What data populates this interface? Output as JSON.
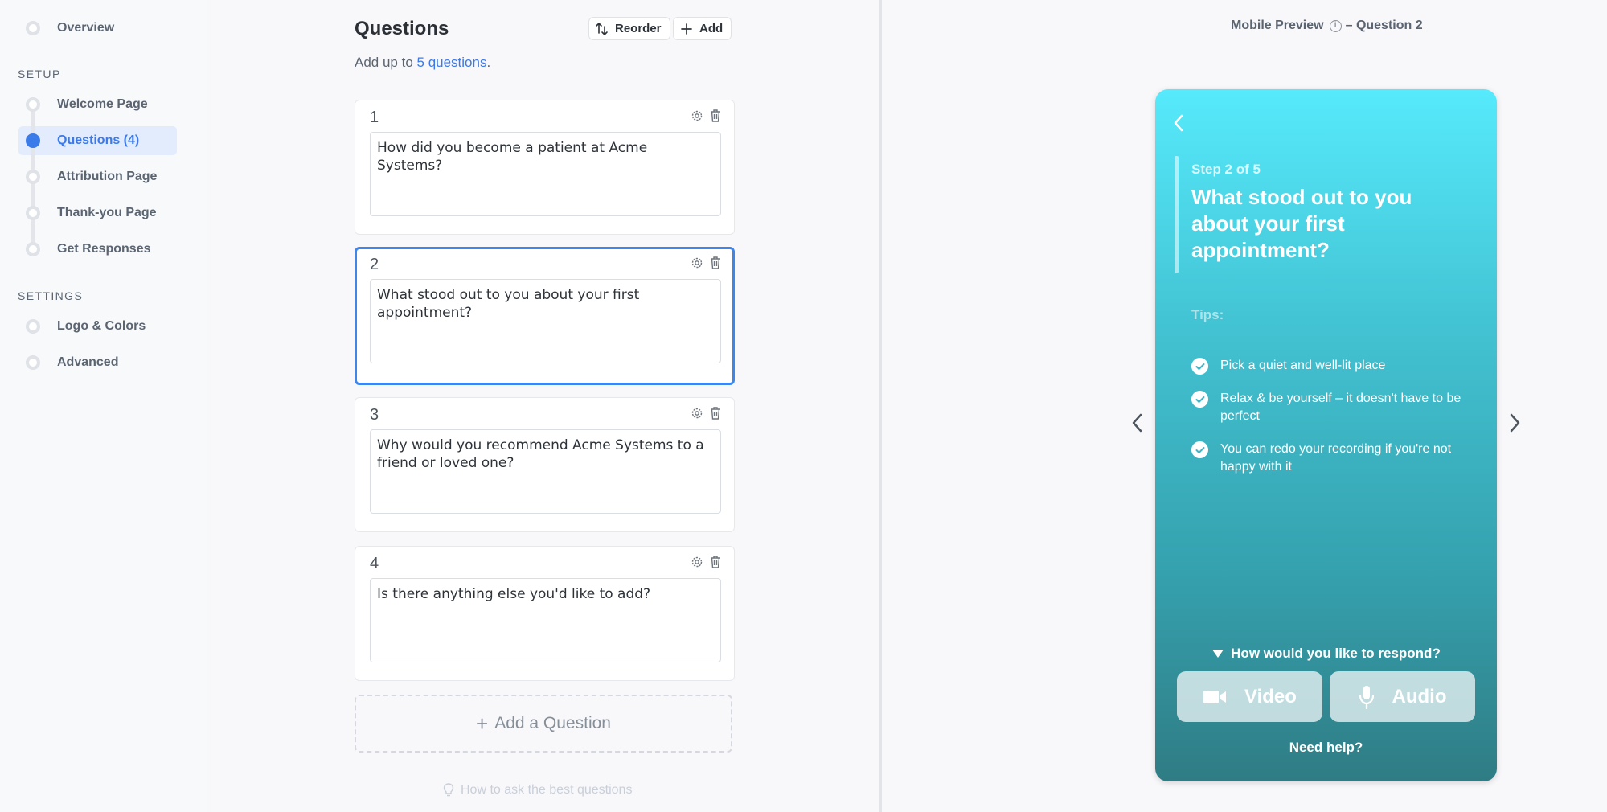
{
  "sidebar": {
    "overview_label": "Overview",
    "setup_label": "SETUP",
    "setup_items": [
      {
        "label": "Welcome Page"
      },
      {
        "label": "Questions (4)"
      },
      {
        "label": "Attribution Page"
      },
      {
        "label": "Thank-you Page"
      },
      {
        "label": "Get Responses"
      }
    ],
    "settings_label": "SETTINGS",
    "settings_items": [
      {
        "label": "Logo & Colors"
      },
      {
        "label": "Advanced"
      }
    ],
    "active_item": "Questions (4)"
  },
  "editor": {
    "title": "Questions",
    "reorder_label": "Reorder",
    "add_label": "Add",
    "subtitle_prefix": "Add up to ",
    "subtitle_link": "5 questions",
    "subtitle_suffix": ".",
    "questions": [
      {
        "number": "1",
        "text": "How did you become a patient at Acme Systems?"
      },
      {
        "number": "2",
        "text": "What stood out to you about your first appointment?"
      },
      {
        "number": "3",
        "text": "Why would you recommend Acme Systems to a friend or loved one?"
      },
      {
        "number": "4",
        "text": "Is there anything else you'd like to add?"
      }
    ],
    "active_question": "2",
    "add_question_label": "Add a Question",
    "add_question_plus": "+",
    "tip_link": "How to ask the best questions"
  },
  "preview": {
    "title": "Mobile Preview",
    "info_glyph": "i",
    "title_suffix": "– Question 2",
    "step_label": "Step 2 of 5",
    "question": "What stood out to you about your first appointment?",
    "tips_label": "Tips:",
    "tips": [
      "Pick a quiet and well-lit place",
      "Relax & be yourself – it doesn't have to be perfect",
      "You can redo your recording if you're not happy with it"
    ],
    "respond_label": "How would you like to respond?",
    "video_label": "Video",
    "audio_label": "Audio",
    "help_label": "Need help?"
  },
  "colors": {
    "accent": "#3b7ae9",
    "gradient_top": "#56eafc",
    "gradient_bottom": "#2f7c84"
  }
}
